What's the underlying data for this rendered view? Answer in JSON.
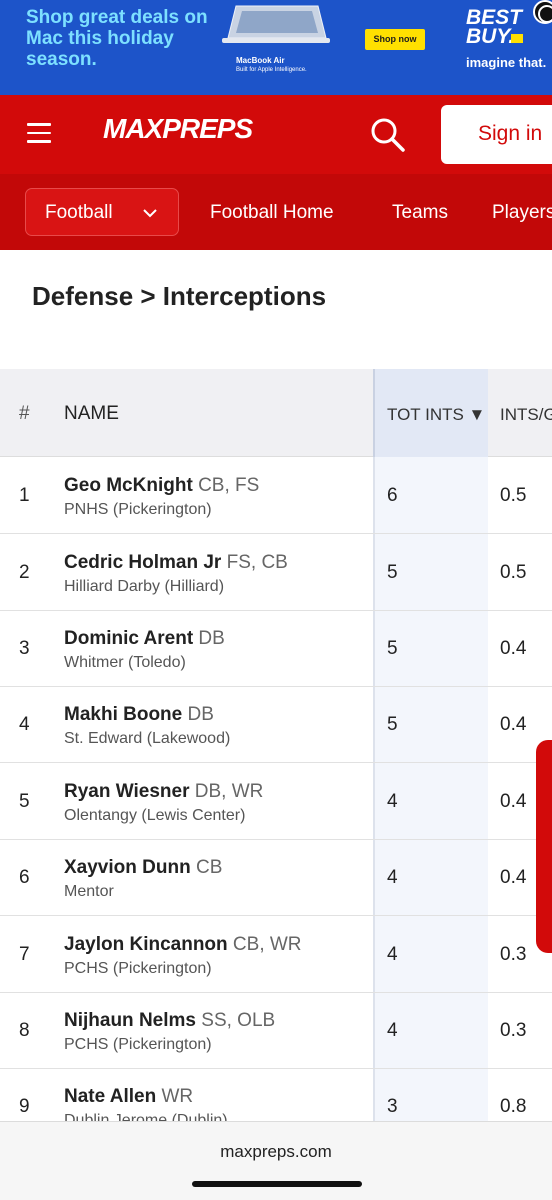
{
  "ad": {
    "headline": "Shop great deals on Mac this holiday season.",
    "product": "MacBook Air",
    "tagline": "Built for Apple Intelligence.",
    "cta": "Shop now",
    "brand": "BEST BUY.",
    "brand_slogan": "imagine that.",
    "colors": {
      "background": "#1d54c9",
      "headline": "#7de0ff",
      "cta": "#ffe000"
    }
  },
  "header": {
    "logo": "MAXPREPS",
    "sign_in": "Sign in",
    "icons": [
      "hamburger-menu-icon",
      "search-icon"
    ],
    "colors": {
      "primary": "#d20a0a"
    }
  },
  "subnav": {
    "sport": "Football",
    "links": [
      "Football Home",
      "Teams",
      "Players"
    ]
  },
  "page": {
    "title": "Defense > Interceptions"
  },
  "table": {
    "columns": {
      "rank": "#",
      "name": "NAME",
      "tot_ints": "TOT INTS ▼",
      "ints_per_game": "INTS/G"
    },
    "rows": [
      {
        "rank": "1",
        "name": "Geo McKnight",
        "pos": "CB, FS",
        "school": "PNHS (Pickerington)",
        "tot": "6",
        "ipg": "0.5"
      },
      {
        "rank": "2",
        "name": "Cedric Holman Jr",
        "pos": "FS, CB",
        "school": "Hilliard Darby (Hilliard)",
        "tot": "5",
        "ipg": "0.5"
      },
      {
        "rank": "3",
        "name": "Dominic Arent",
        "pos": "DB",
        "school": "Whitmer (Toledo)",
        "tot": "5",
        "ipg": "0.4"
      },
      {
        "rank": "4",
        "name": "Makhi Boone",
        "pos": "DB",
        "school": "St. Edward (Lakewood)",
        "tot": "5",
        "ipg": "0.4"
      },
      {
        "rank": "5",
        "name": "Ryan Wiesner",
        "pos": "DB, WR",
        "school": "Olentangy (Lewis Center)",
        "tot": "4",
        "ipg": "0.4"
      },
      {
        "rank": "6",
        "name": "Xayvion Dunn",
        "pos": "CB",
        "school": "Mentor",
        "tot": "4",
        "ipg": "0.4"
      },
      {
        "rank": "7",
        "name": "Jaylon Kincannon",
        "pos": "CB, WR",
        "school": "PCHS (Pickerington)",
        "tot": "4",
        "ipg": "0.3"
      },
      {
        "rank": "8",
        "name": "Nijhaun Nelms",
        "pos": "SS, OLB",
        "school": "PCHS (Pickerington)",
        "tot": "4",
        "ipg": "0.3"
      },
      {
        "rank": "9",
        "name": "Nate Allen",
        "pos": "WR",
        "school": "Dublin Jerome (Dublin)",
        "tot": "3",
        "ipg": "0.8"
      }
    ]
  },
  "browser": {
    "url": "maxpreps.com"
  }
}
